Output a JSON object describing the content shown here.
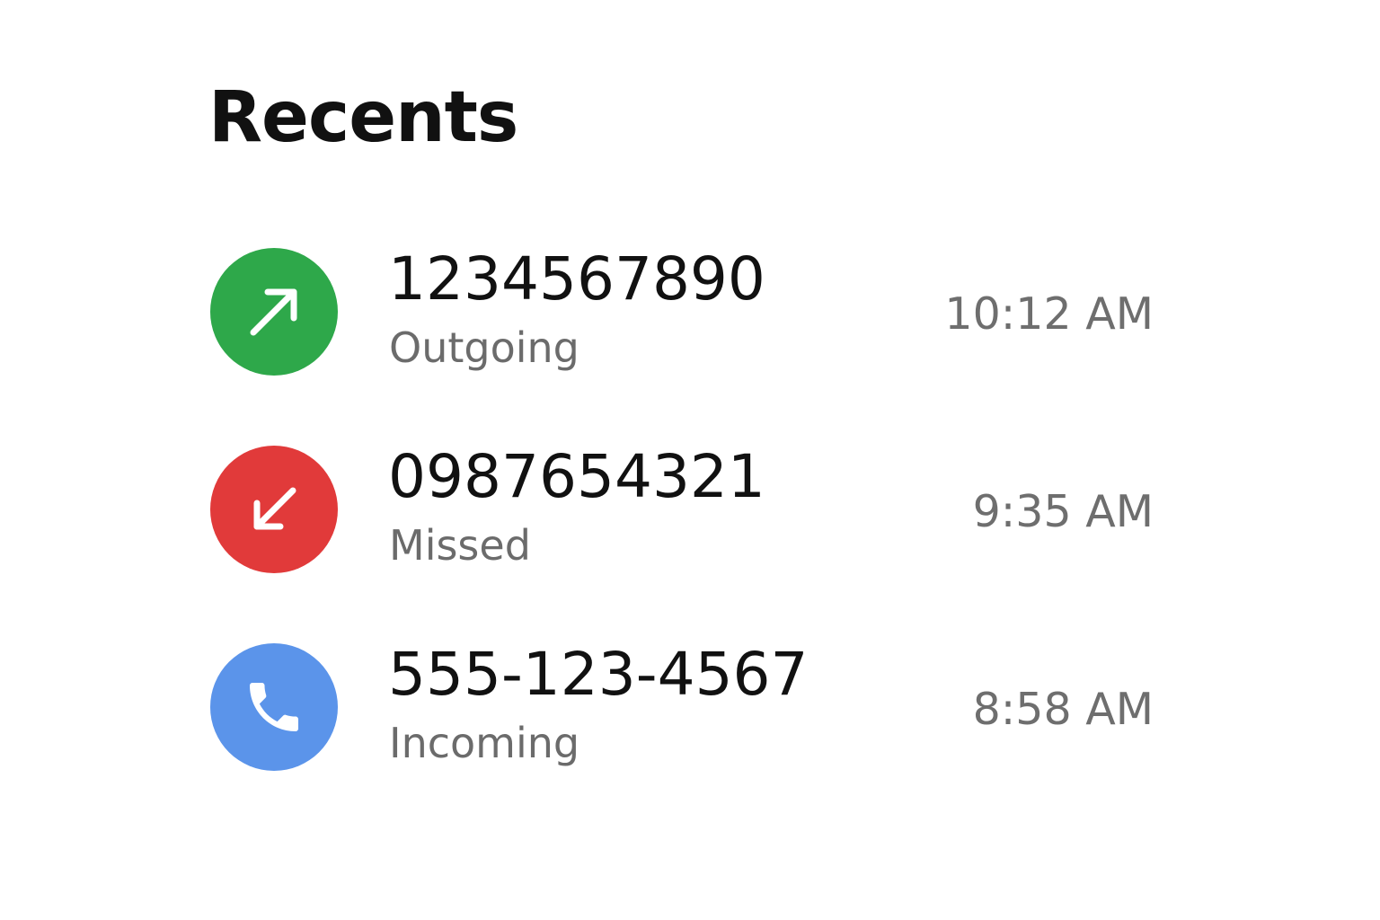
{
  "header": {
    "title": "Recents"
  },
  "calls": [
    {
      "number": "1234567890",
      "type": "Outgoing",
      "time": "10:12 AM",
      "icon": "outgoing-arrow-icon",
      "color": "#2ea84a"
    },
    {
      "number": "0987654321",
      "type": "Missed",
      "time": "9:35 AM",
      "icon": "missed-arrow-icon",
      "color": "#e13a3a"
    },
    {
      "number": "555-123-4567",
      "type": "Incoming",
      "time": "8:58 AM",
      "icon": "phone-icon",
      "color": "#5b94ea"
    }
  ]
}
